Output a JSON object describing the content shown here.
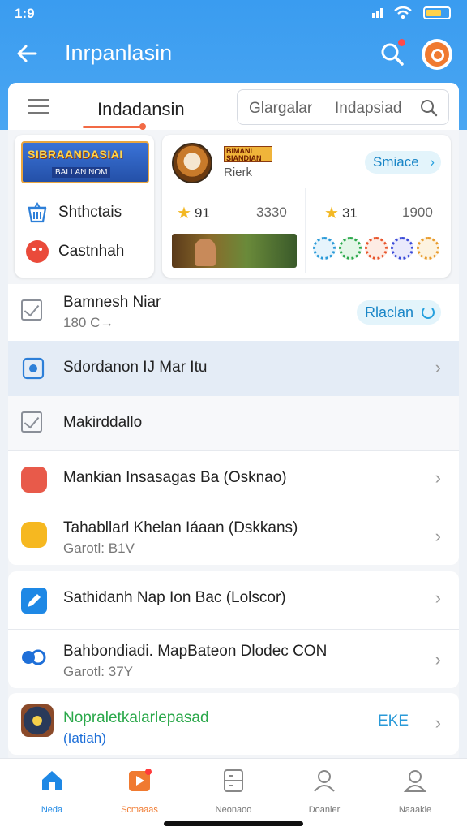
{
  "status_bar": {
    "time": "1:9"
  },
  "appbar": {
    "title": "Inrpanlasin"
  },
  "toolbar": {
    "active_tab": "Indadansin",
    "search_left": "Glargalar",
    "search_right": "Indapsiad"
  },
  "cards": {
    "banner_title": "SIBRAANDASIAI",
    "banner_subtitle": "BALLAN NOM",
    "item1_label": "Shthctais",
    "item2_label": "Castnhah",
    "logo_text": "BIMANI SIANDIAN",
    "game_subtitle": "Rierk",
    "game_button": "Smiace",
    "stat1_rating": "91",
    "stat1_count": "3330",
    "stat2_rating": "31",
    "stat2_count": "1900"
  },
  "list": [
    {
      "title": "Bamnesh Niar",
      "sub": "180 C→",
      "pill": "Rlaclan"
    },
    {
      "title": "Sdordanon IJ Mar Itu"
    },
    {
      "title": "Makirddallo"
    },
    {
      "title": "Mankian Insasagas Ba (Osknao)"
    },
    {
      "title": "Tahabllarl Khelan Iáaan (Dskkans)",
      "sub": "Garotl:  B1V"
    },
    {
      "title": "Sathidanh Nap Ion Bac (Lolscor)"
    },
    {
      "title": "Bahbondiadi. MapBateon Dlodec CON",
      "sub": "Garotl:  37Y"
    },
    {
      "title": "Nopraletkalarlepasad",
      "sub": "(Iatiah)",
      "tag": "EKE"
    }
  ],
  "bottom_nav": [
    {
      "label": "Neda"
    },
    {
      "label": "Scmaaas"
    },
    {
      "label": "Neonaoo"
    },
    {
      "label": "Doanler"
    },
    {
      "label": "Naaakie"
    }
  ],
  "colors": {
    "accent": "#3a9cf0",
    "active_nav": "#f07a30",
    "link": "#1a86c7"
  }
}
